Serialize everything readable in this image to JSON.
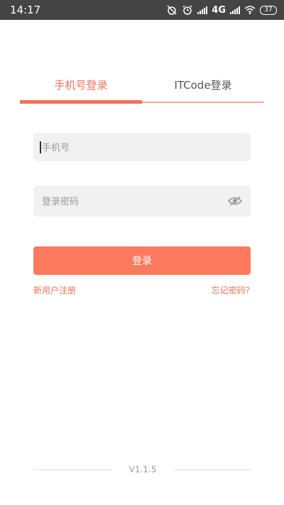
{
  "status_bar": {
    "time": "14:17",
    "network": "4G",
    "network_sub": "↑↓",
    "battery": "37",
    "icons": [
      "alarm-off-icon",
      "alarm-clock-icon",
      "signal-icon",
      "wifi-icon",
      "battery-icon"
    ]
  },
  "tabs": [
    {
      "label": "手机号登录",
      "active": true
    },
    {
      "label": "ITCode登录",
      "active": false
    }
  ],
  "form": {
    "phone_placeholder": "手机号",
    "phone_value": "",
    "password_placeholder": "登录密码",
    "password_value": "",
    "password_visibility_icon": "eye-icon",
    "login_label": "登录"
  },
  "links": {
    "register": "新用户注册",
    "forgot": "忘记密码?"
  },
  "footer": {
    "version": "V1.1.5"
  },
  "colors": {
    "accent": "#f0735a",
    "button": "#fd7a5e",
    "status_bar": "#444444",
    "input_bg": "#f1f1f1"
  }
}
